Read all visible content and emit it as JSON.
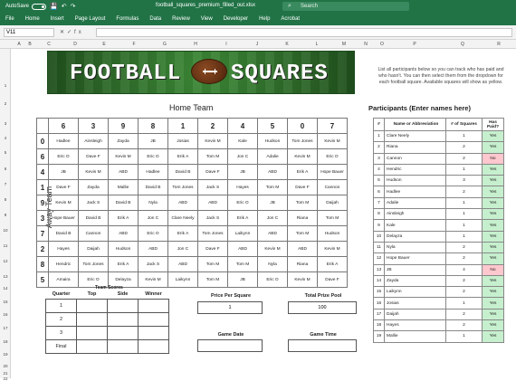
{
  "titlebar": {
    "autosave": "AutoSave",
    "toggle_state": "Off",
    "filename": "football_squares_premium_filled_out.xlsx",
    "search_placeholder": "Search"
  },
  "ribbon": {
    "tabs": [
      "File",
      "Home",
      "Insert",
      "Page Layout",
      "Formulas",
      "Data",
      "Review",
      "View",
      "Developer",
      "Help",
      "Acrobat"
    ]
  },
  "formula_bar": {
    "name_box": "V11",
    "value": ""
  },
  "columns": [
    "A",
    "B",
    "C",
    "D",
    "E",
    "F",
    "G",
    "H",
    "I",
    "J",
    "K",
    "L",
    "M",
    "N",
    "O",
    "P",
    "Q",
    "R"
  ],
  "rows": [
    "1",
    "2",
    "3",
    "4",
    "5",
    "6",
    "7",
    "8",
    "9",
    "10",
    "11",
    "12",
    "13",
    "14",
    "15",
    "16",
    "17",
    "18",
    "19",
    "20",
    "21",
    "22"
  ],
  "banner": {
    "word1": "FOOTBALL",
    "word2": "SQUARES"
  },
  "home_team": "Home Team",
  "away_team": "Away Team",
  "home_numbers": [
    "6",
    "3",
    "9",
    "8",
    "1",
    "2",
    "4",
    "5",
    "0",
    "7"
  ],
  "away_numbers": [
    "0",
    "6",
    "4",
    "1",
    "9",
    "3",
    "7",
    "2",
    "8",
    "5"
  ],
  "grid": [
    [
      "Hadlee",
      "Ainsleigh",
      "Zayda",
      "JB",
      "Josias",
      "Kevin M",
      "Kale",
      "Hudson",
      "Tom Jones",
      "Kevin M"
    ],
    [
      "Eric O",
      "Dave F",
      "Kevin M",
      "Eric O",
      "Erik A",
      "Tom M",
      "Jon C",
      "Adalie",
      "Kevin M",
      "Eric O"
    ],
    [
      "JB",
      "Kevin M",
      "ABD",
      "Hadlee",
      "David B",
      "Dave F",
      "JB",
      "ABD",
      "Erik A",
      "Hope Bauer"
    ],
    [
      "Dave F",
      "Zayda",
      "Mallie",
      "David B",
      "Tom Jones",
      "Jack S",
      "Hayes",
      "Tom M",
      "Dave F",
      "Cannon"
    ],
    [
      "Kevin M",
      "Jack S",
      "David B",
      "Nyla",
      "ABD",
      "ABD",
      "Eric O",
      "JB",
      "Tom M",
      "Daijah"
    ],
    [
      "Hope Bauer",
      "David B",
      "Erik A",
      "Jon C",
      "Clare Neely",
      "Jack S",
      "Erik A",
      "Jon C",
      "Riana",
      "Tom M"
    ],
    [
      "David B",
      "Cannon",
      "ABD",
      "Eric O",
      "Erik A",
      "Tom Jones",
      "Laikynn",
      "ABD",
      "Tom M",
      "Hudson"
    ],
    [
      "Hayes",
      "Daijah",
      "Hudson",
      "ABD",
      "Jon C",
      "Dave F",
      "ABD",
      "Kevin M",
      "ABD",
      "Kevin M"
    ],
    [
      "Hendric",
      "Tom Jones",
      "Erik A",
      "Jack S",
      "ABD",
      "Tom M",
      "Tom M",
      "Nyla",
      "Riana",
      "Erik A"
    ],
    [
      "Amaira",
      "Eric O",
      "Delayza",
      "Kevin M",
      "Laikynn",
      "Tom M",
      "JB",
      "Eric O",
      "Kevin M",
      "Dave F"
    ]
  ],
  "instructions": "List all participants below so you can track who has paid and who hasn't. You can then select them from the dropdown for each football square. Available squares will show as yellow.",
  "participants_title": "Participants (Enter names here)",
  "participants_headers": [
    "#",
    "Name or Abbreviation",
    "# of Squares",
    "Has Paid?"
  ],
  "participants": [
    [
      "1",
      "Clare Neely",
      "1",
      "Yes"
    ],
    [
      "2",
      "Riana",
      "2",
      "Yes"
    ],
    [
      "3",
      "Cannon",
      "2",
      "No"
    ],
    [
      "4",
      "Hendric",
      "1",
      "Yes"
    ],
    [
      "5",
      "Hudson",
      "3",
      "Yes"
    ],
    [
      "6",
      "Hadlee",
      "2",
      "Yes"
    ],
    [
      "7",
      "Adalie",
      "1",
      "Yes"
    ],
    [
      "8",
      "Ainsleigh",
      "1",
      "Yes"
    ],
    [
      "9",
      "Kale",
      "1",
      "Yes"
    ],
    [
      "10",
      "Delayza",
      "1",
      "Yes"
    ],
    [
      "11",
      "Nyla",
      "2",
      "Yes"
    ],
    [
      "12",
      "Hope Bauer",
      "2",
      "Yes"
    ],
    [
      "13",
      "JB",
      "4",
      "No"
    ],
    [
      "14",
      "Zayda",
      "2",
      "Yes"
    ],
    [
      "15",
      "Laikynn",
      "2",
      "Yes"
    ],
    [
      "16",
      "Josias",
      "1",
      "Yes"
    ],
    [
      "17",
      "Daijah",
      "2",
      "Yes"
    ],
    [
      "18",
      "Hayes",
      "2",
      "Yes"
    ],
    [
      "19",
      "Mallie",
      "1",
      "Yes"
    ]
  ],
  "team_scores": {
    "title": "Team Scores",
    "headers": [
      "Quarter",
      "Top",
      "Side",
      "Winner"
    ],
    "quarters": [
      "1",
      "2",
      "3",
      "Final"
    ]
  },
  "price_per_square": {
    "label": "Price Per Square",
    "value": "1"
  },
  "total_prize_pool": {
    "label": "Total Prize Pool",
    "value": "100"
  },
  "game_date": {
    "label": "Game Date",
    "value": ""
  },
  "game_time": {
    "label": "Game Time",
    "value": ""
  },
  "colors": {
    "excel_green": "#217346",
    "yes_bg": "#c6efce",
    "no_bg": "#ffc7ce"
  }
}
